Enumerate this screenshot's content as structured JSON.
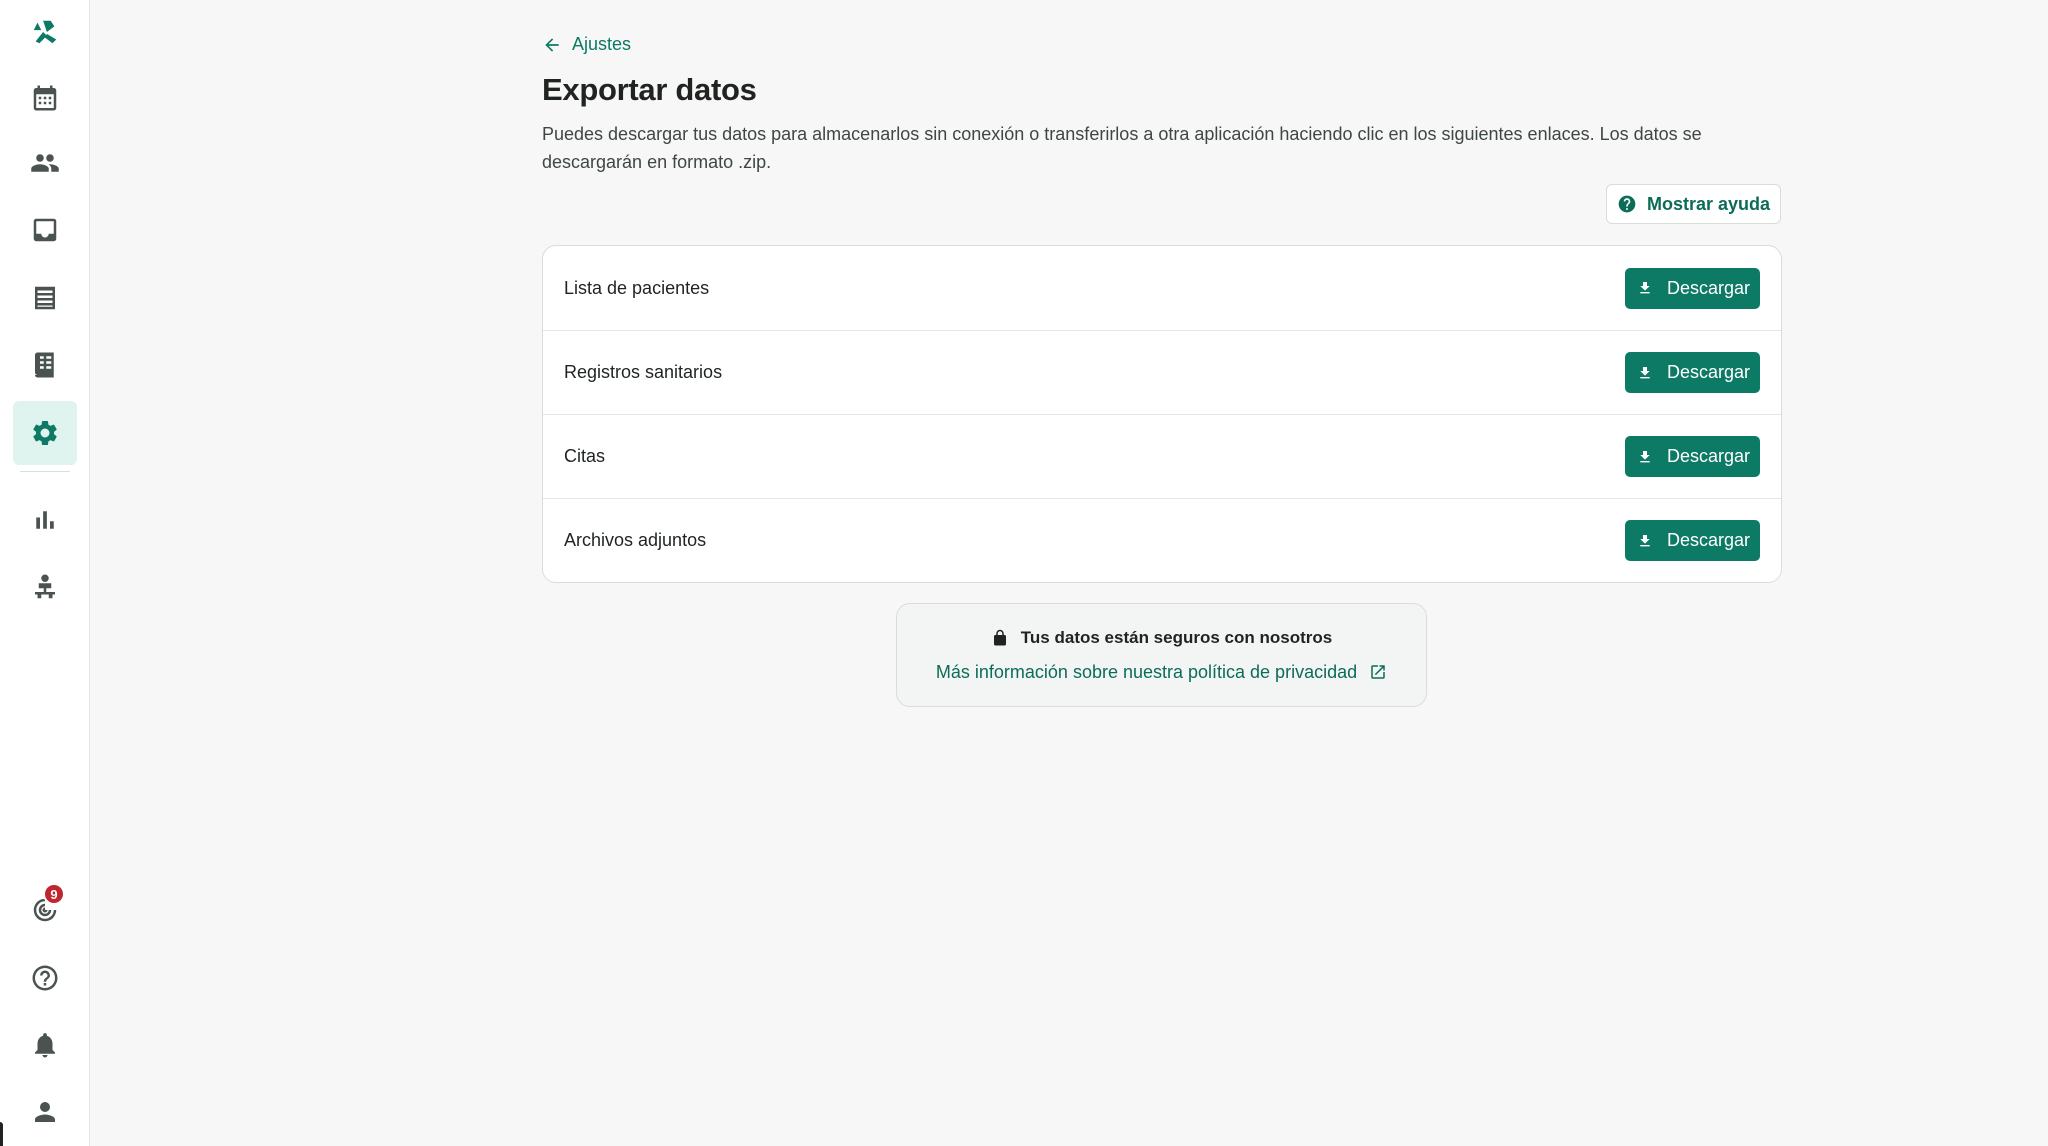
{
  "sidebar": {
    "logo_icon": "app-logo-icon",
    "items": [
      {
        "name": "calendar",
        "icon": "calendar-icon"
      },
      {
        "name": "patients",
        "icon": "people-icon"
      },
      {
        "name": "inbox",
        "icon": "inbox-icon"
      },
      {
        "name": "records",
        "icon": "list-icon"
      },
      {
        "name": "billing",
        "icon": "receipt-icon"
      },
      {
        "name": "settings",
        "icon": "gear-icon",
        "active": true
      },
      {
        "name": "reports",
        "icon": "bar-chart-icon"
      },
      {
        "name": "team",
        "icon": "org-chart-icon"
      }
    ],
    "bottom": {
      "updates_badge": "9",
      "items": [
        "updates-icon",
        "help-icon",
        "bell-icon",
        "user-icon"
      ]
    }
  },
  "header": {
    "back_label": "Ajustes",
    "title": "Exportar datos",
    "description": "Puedes descargar tus datos para almacenarlos sin conexión o transferirlos a otra aplicación haciendo clic en los siguientes enlaces. Los datos se descargarán en formato .zip.",
    "help_button": "Mostrar ayuda"
  },
  "exports": [
    {
      "label": "Lista de pacientes",
      "button": "Descargar"
    },
    {
      "label": "Registros sanitarios",
      "button": "Descargar"
    },
    {
      "label": "Citas",
      "button": "Descargar"
    },
    {
      "label": "Archivos adjuntos",
      "button": "Descargar"
    }
  ],
  "security": {
    "title": "Tus datos están seguros con nosotros",
    "link": "Más información sobre nuestra política de privacidad"
  },
  "colors": {
    "accent": "#0c7a64",
    "accent_light": "#dff4ee",
    "badge": "#c0262d",
    "background": "#f6f7f6"
  }
}
